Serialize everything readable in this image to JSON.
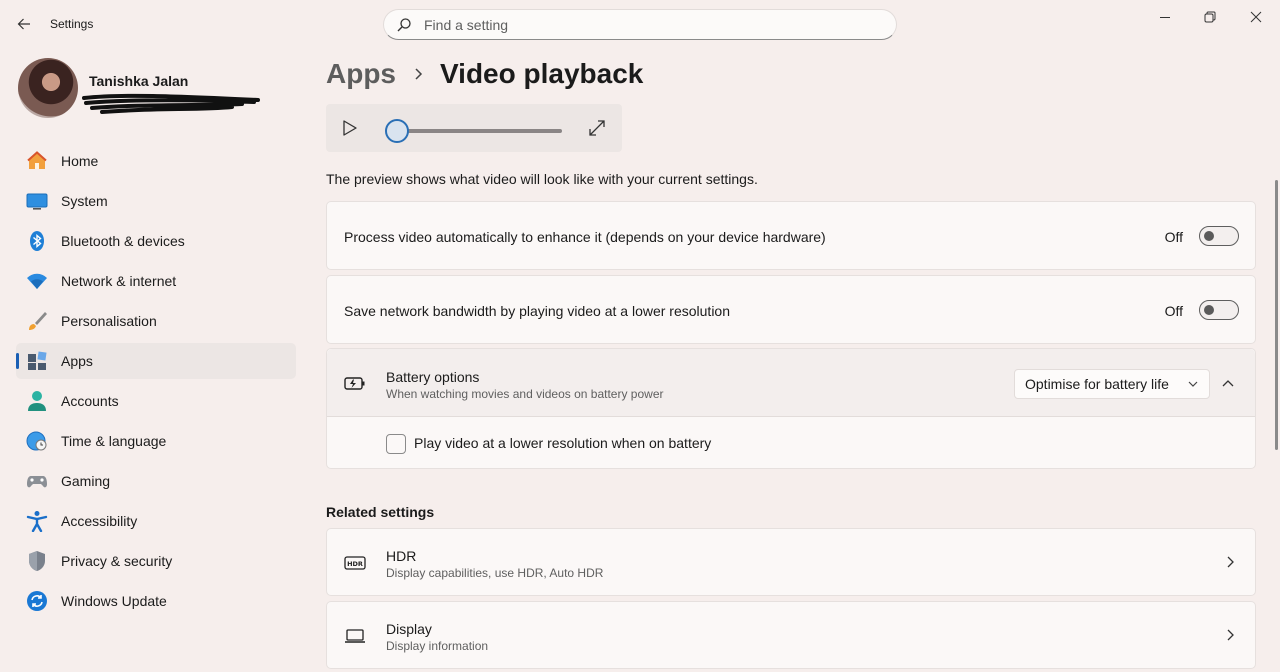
{
  "window": {
    "app_title": "Settings"
  },
  "search": {
    "placeholder": "Find a setting"
  },
  "profile": {
    "name": "Tanishka Jalan"
  },
  "sidebar": {
    "items": [
      {
        "label": "Home",
        "icon": "home-icon"
      },
      {
        "label": "System",
        "icon": "system-icon"
      },
      {
        "label": "Bluetooth & devices",
        "icon": "bluetooth-icon"
      },
      {
        "label": "Network & internet",
        "icon": "wifi-icon"
      },
      {
        "label": "Personalisation",
        "icon": "brush-icon"
      },
      {
        "label": "Apps",
        "icon": "apps-icon",
        "active": true
      },
      {
        "label": "Accounts",
        "icon": "accounts-icon"
      },
      {
        "label": "Time & language",
        "icon": "globe-clock-icon"
      },
      {
        "label": "Gaming",
        "icon": "gamepad-icon"
      },
      {
        "label": "Accessibility",
        "icon": "accessibility-icon"
      },
      {
        "label": "Privacy & security",
        "icon": "shield-icon"
      },
      {
        "label": "Windows Update",
        "icon": "update-icon"
      }
    ]
  },
  "breadcrumb": {
    "parent": "Apps",
    "current": "Video playback"
  },
  "player": {
    "position": 0
  },
  "preview_note": "The preview shows what video will look like with your current settings.",
  "settings": {
    "process_video": {
      "label": "Process video automatically to enhance it (depends on your device hardware)",
      "state": "Off"
    },
    "save_bandwidth": {
      "label": "Save network bandwidth by playing video at a lower resolution",
      "state": "Off"
    }
  },
  "battery": {
    "title": "Battery options",
    "subtitle": "When watching movies and videos on battery power",
    "selected": "Optimise for battery life",
    "checkbox_label": "Play video at a lower resolution when on battery"
  },
  "related": {
    "heading": "Related settings",
    "items": [
      {
        "title": "HDR",
        "subtitle": "Display capabilities, use HDR, Auto HDR"
      },
      {
        "title": "Display",
        "subtitle": "Display information"
      }
    ]
  },
  "colors": {
    "accent": "#1a5fb4",
    "background": "#f6eeec"
  }
}
